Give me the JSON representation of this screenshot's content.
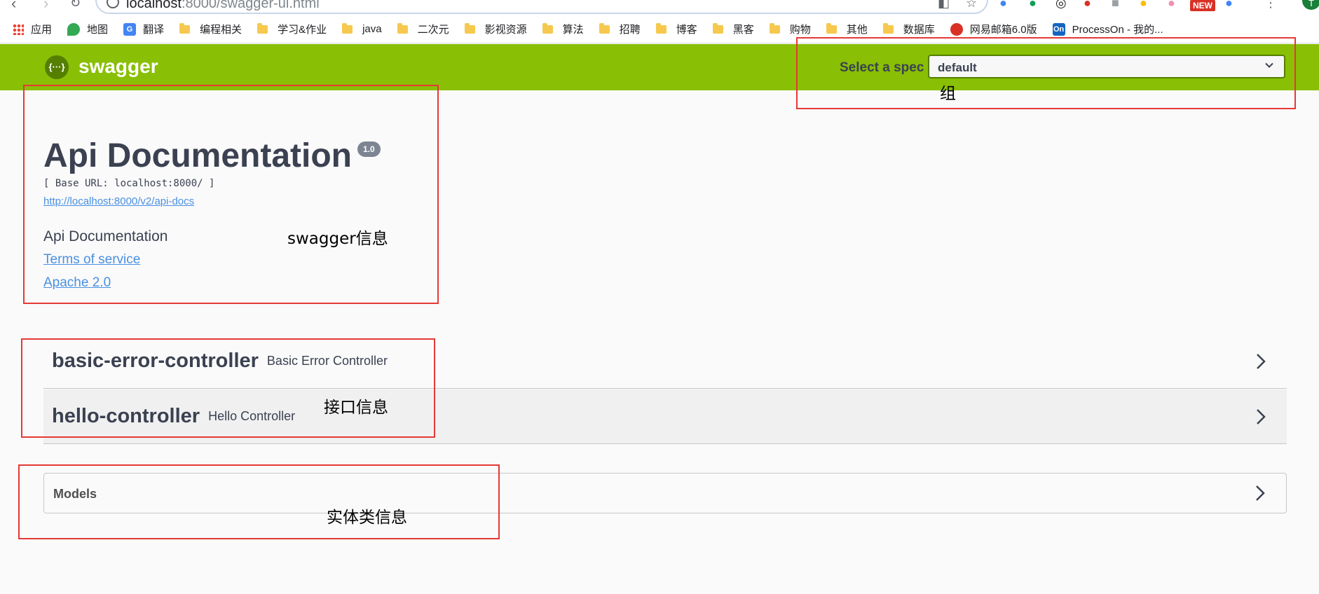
{
  "browser": {
    "url_host": "localhost",
    "url_rest": ":8000/swagger-ui.html",
    "new_badge": "NEW",
    "avatar_letter": "T",
    "bookmarks": [
      {
        "label": "应用",
        "icon": "apps-icon"
      },
      {
        "label": "地图",
        "icon": "maps-pin-icon"
      },
      {
        "label": "翻译",
        "icon": "translate-icon"
      },
      {
        "label": "编程相关",
        "icon": "folder-icon"
      },
      {
        "label": "学习&作业",
        "icon": "folder-icon"
      },
      {
        "label": "java",
        "icon": "folder-icon"
      },
      {
        "label": "二次元",
        "icon": "folder-icon"
      },
      {
        "label": "影视资源",
        "icon": "folder-icon"
      },
      {
        "label": "算法",
        "icon": "folder-icon"
      },
      {
        "label": "招聘",
        "icon": "folder-icon"
      },
      {
        "label": "博客",
        "icon": "folder-icon"
      },
      {
        "label": "黑客",
        "icon": "folder-icon"
      },
      {
        "label": "购物",
        "icon": "folder-icon"
      },
      {
        "label": "其他",
        "icon": "folder-icon"
      },
      {
        "label": "数据库",
        "icon": "folder-icon"
      },
      {
        "label": "网易邮箱6.0版",
        "icon": "netease-mail-icon"
      },
      {
        "label": "ProcessOn - 我的...",
        "icon": "processon-icon"
      }
    ]
  },
  "topbar": {
    "logo_text": "swagger",
    "logo_glyph": "{···}",
    "spec_label": "Select a spec",
    "spec_value": "default",
    "color": "#89bf04"
  },
  "info": {
    "title": "Api Documentation",
    "version": "1.0",
    "base_url": "[ Base URL: localhost:8000/ ]",
    "api_docs_link": "http://localhost:8000/v2/api-docs",
    "description": "Api Documentation",
    "terms_link": "Terms of service",
    "license_link": "Apache 2.0"
  },
  "controllers": [
    {
      "name": "basic-error-controller",
      "description": "Basic Error Controller"
    },
    {
      "name": "hello-controller",
      "description": "Hello Controller"
    }
  ],
  "models": {
    "label": "Models"
  },
  "annotations": {
    "group": "组",
    "swagger_info": "swagger信息",
    "api_info": "接口信息",
    "entity_info": "实体类信息",
    "color": "#e53935"
  }
}
